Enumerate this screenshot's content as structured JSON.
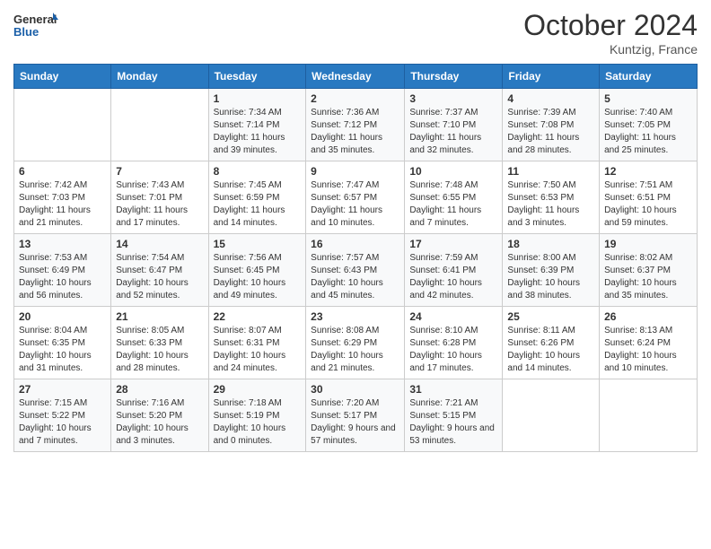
{
  "header": {
    "logo_line1": "General",
    "logo_line2": "Blue",
    "month_title": "October 2024",
    "location": "Kuntzig, France"
  },
  "weekdays": [
    "Sunday",
    "Monday",
    "Tuesday",
    "Wednesday",
    "Thursday",
    "Friday",
    "Saturday"
  ],
  "weeks": [
    [
      {
        "day": "",
        "info": ""
      },
      {
        "day": "",
        "info": ""
      },
      {
        "day": "1",
        "info": "Sunrise: 7:34 AM\nSunset: 7:14 PM\nDaylight: 11 hours and 39 minutes."
      },
      {
        "day": "2",
        "info": "Sunrise: 7:36 AM\nSunset: 7:12 PM\nDaylight: 11 hours and 35 minutes."
      },
      {
        "day": "3",
        "info": "Sunrise: 7:37 AM\nSunset: 7:10 PM\nDaylight: 11 hours and 32 minutes."
      },
      {
        "day": "4",
        "info": "Sunrise: 7:39 AM\nSunset: 7:08 PM\nDaylight: 11 hours and 28 minutes."
      },
      {
        "day": "5",
        "info": "Sunrise: 7:40 AM\nSunset: 7:05 PM\nDaylight: 11 hours and 25 minutes."
      }
    ],
    [
      {
        "day": "6",
        "info": "Sunrise: 7:42 AM\nSunset: 7:03 PM\nDaylight: 11 hours and 21 minutes."
      },
      {
        "day": "7",
        "info": "Sunrise: 7:43 AM\nSunset: 7:01 PM\nDaylight: 11 hours and 17 minutes."
      },
      {
        "day": "8",
        "info": "Sunrise: 7:45 AM\nSunset: 6:59 PM\nDaylight: 11 hours and 14 minutes."
      },
      {
        "day": "9",
        "info": "Sunrise: 7:47 AM\nSunset: 6:57 PM\nDaylight: 11 hours and 10 minutes."
      },
      {
        "day": "10",
        "info": "Sunrise: 7:48 AM\nSunset: 6:55 PM\nDaylight: 11 hours and 7 minutes."
      },
      {
        "day": "11",
        "info": "Sunrise: 7:50 AM\nSunset: 6:53 PM\nDaylight: 11 hours and 3 minutes."
      },
      {
        "day": "12",
        "info": "Sunrise: 7:51 AM\nSunset: 6:51 PM\nDaylight: 10 hours and 59 minutes."
      }
    ],
    [
      {
        "day": "13",
        "info": "Sunrise: 7:53 AM\nSunset: 6:49 PM\nDaylight: 10 hours and 56 minutes."
      },
      {
        "day": "14",
        "info": "Sunrise: 7:54 AM\nSunset: 6:47 PM\nDaylight: 10 hours and 52 minutes."
      },
      {
        "day": "15",
        "info": "Sunrise: 7:56 AM\nSunset: 6:45 PM\nDaylight: 10 hours and 49 minutes."
      },
      {
        "day": "16",
        "info": "Sunrise: 7:57 AM\nSunset: 6:43 PM\nDaylight: 10 hours and 45 minutes."
      },
      {
        "day": "17",
        "info": "Sunrise: 7:59 AM\nSunset: 6:41 PM\nDaylight: 10 hours and 42 minutes."
      },
      {
        "day": "18",
        "info": "Sunrise: 8:00 AM\nSunset: 6:39 PM\nDaylight: 10 hours and 38 minutes."
      },
      {
        "day": "19",
        "info": "Sunrise: 8:02 AM\nSunset: 6:37 PM\nDaylight: 10 hours and 35 minutes."
      }
    ],
    [
      {
        "day": "20",
        "info": "Sunrise: 8:04 AM\nSunset: 6:35 PM\nDaylight: 10 hours and 31 minutes."
      },
      {
        "day": "21",
        "info": "Sunrise: 8:05 AM\nSunset: 6:33 PM\nDaylight: 10 hours and 28 minutes."
      },
      {
        "day": "22",
        "info": "Sunrise: 8:07 AM\nSunset: 6:31 PM\nDaylight: 10 hours and 24 minutes."
      },
      {
        "day": "23",
        "info": "Sunrise: 8:08 AM\nSunset: 6:29 PM\nDaylight: 10 hours and 21 minutes."
      },
      {
        "day": "24",
        "info": "Sunrise: 8:10 AM\nSunset: 6:28 PM\nDaylight: 10 hours and 17 minutes."
      },
      {
        "day": "25",
        "info": "Sunrise: 8:11 AM\nSunset: 6:26 PM\nDaylight: 10 hours and 14 minutes."
      },
      {
        "day": "26",
        "info": "Sunrise: 8:13 AM\nSunset: 6:24 PM\nDaylight: 10 hours and 10 minutes."
      }
    ],
    [
      {
        "day": "27",
        "info": "Sunrise: 7:15 AM\nSunset: 5:22 PM\nDaylight: 10 hours and 7 minutes."
      },
      {
        "day": "28",
        "info": "Sunrise: 7:16 AM\nSunset: 5:20 PM\nDaylight: 10 hours and 3 minutes."
      },
      {
        "day": "29",
        "info": "Sunrise: 7:18 AM\nSunset: 5:19 PM\nDaylight: 10 hours and 0 minutes."
      },
      {
        "day": "30",
        "info": "Sunrise: 7:20 AM\nSunset: 5:17 PM\nDaylight: 9 hours and 57 minutes."
      },
      {
        "day": "31",
        "info": "Sunrise: 7:21 AM\nSunset: 5:15 PM\nDaylight: 9 hours and 53 minutes."
      },
      {
        "day": "",
        "info": ""
      },
      {
        "day": "",
        "info": ""
      }
    ]
  ]
}
